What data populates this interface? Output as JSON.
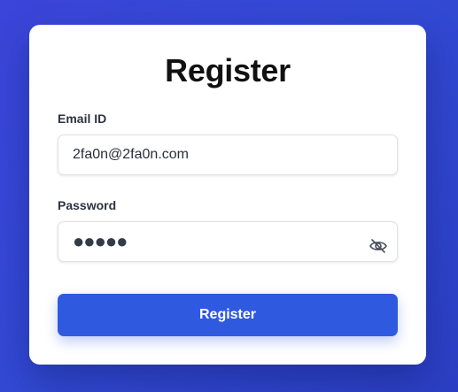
{
  "form": {
    "title": "Register",
    "email_label": "Email ID",
    "email_value": "2fa0n@2fa0n.com",
    "password_label": "Password",
    "password_value": "●●●●●",
    "toggle_icon": "eye-off-icon",
    "submit_label": "Register"
  },
  "colors": {
    "background": "#3249d3",
    "card": "#ffffff",
    "button": "#2f5ae0",
    "title_text": "#111111"
  }
}
